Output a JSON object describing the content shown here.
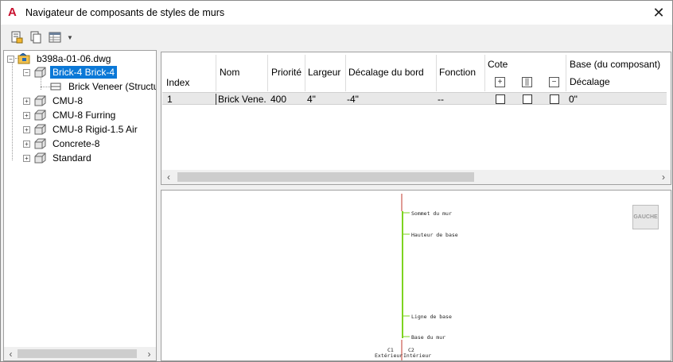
{
  "window": {
    "title": "Navigateur de composants de styles de murs",
    "app_icon_letter": "A",
    "close_glyph": "✕"
  },
  "toolbar": {
    "icons": [
      "new-component-icon",
      "copy-component-icon",
      "table-view-icon"
    ],
    "dropdown_glyph": "▼"
  },
  "tree": {
    "root": "b398a-01-06.dwg",
    "styles": [
      {
        "label": "Brick-4 Brick-4",
        "expanded": true,
        "selected": true,
        "children": [
          {
            "label": "Brick Veneer (Structu"
          }
        ]
      },
      {
        "label": "CMU-8"
      },
      {
        "label": "CMU-8 Furring"
      },
      {
        "label": "CMU-8 Rigid-1.5 Air"
      },
      {
        "label": "Concrete-8"
      },
      {
        "label": "Standard"
      }
    ]
  },
  "grid": {
    "headers": {
      "index": "Index",
      "nom": "Nom",
      "priorite": "Priorité",
      "largeur": "Largeur",
      "decalage_bord": "Décalage du bord",
      "fonction": "Fonction",
      "cote": "Cote",
      "base_composant": "Base (du composant)",
      "decalage": "Décalage"
    },
    "rows": [
      {
        "index": "1",
        "nom": "Brick Vene...",
        "priorite": "400",
        "largeur": "4\"",
        "decalage_bord": "-4\"",
        "fonction": "--",
        "cote_checks": [
          false,
          false,
          false
        ],
        "decalage": "0\""
      }
    ]
  },
  "preview": {
    "gauche_label": "GAUCHE",
    "labels": {
      "sommet": "Sommet du mur",
      "hauteur": "Hauteur de base",
      "ligne": "Ligne de base",
      "base": "Base du mur",
      "exterieur": "Extérieur",
      "interieur": "Intérieur",
      "c1": "C1",
      "c2": "C2"
    },
    "colors": {
      "wall_line": "#7ed321",
      "axis_line": "#c0392b"
    }
  },
  "colors": {
    "selection": "#0a78d7",
    "app_red": "#c8102e"
  }
}
